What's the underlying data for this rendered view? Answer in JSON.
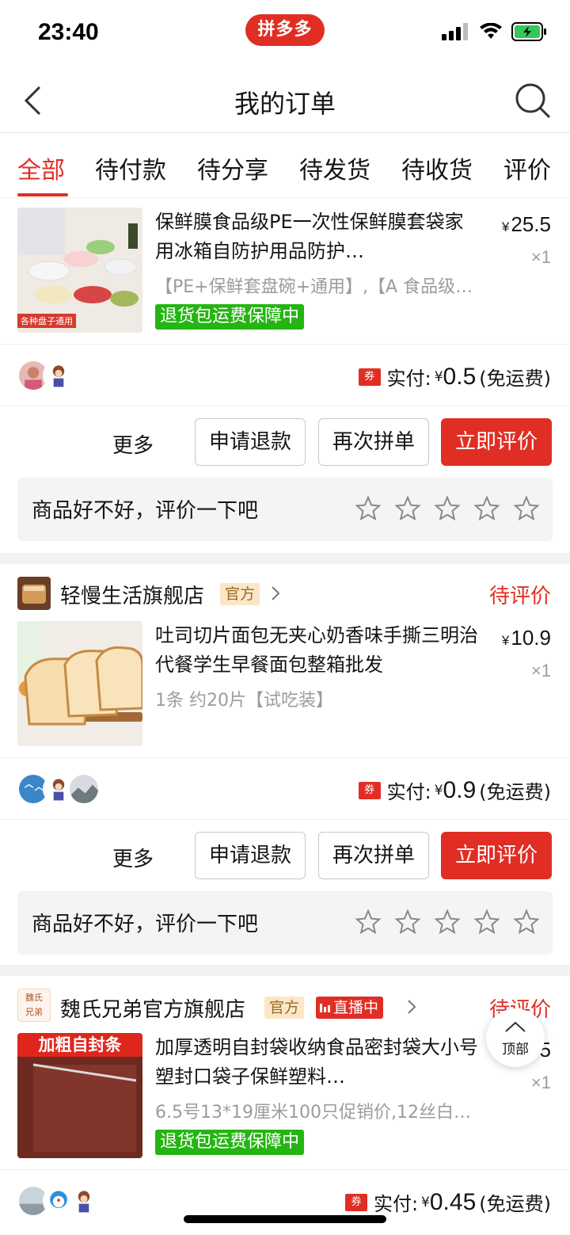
{
  "status_bar": {
    "time": "23:40",
    "brand": "拼多多"
  },
  "nav": {
    "title": "我的订单"
  },
  "tabs": [
    {
      "label": "全部",
      "active": true
    },
    {
      "label": "待付款"
    },
    {
      "label": "待分享"
    },
    {
      "label": "待发货"
    },
    {
      "label": "待收货"
    },
    {
      "label": "评价"
    }
  ],
  "orders": [
    {
      "product": {
        "title": "保鲜膜食品级PE一次性保鲜膜套袋家用冰箱自防护用品防护…",
        "spec": "【PE+保鲜套盘碗+通用】,【A 食品级…",
        "price": "25.5",
        "qty": "×1",
        "tag": "退货包运费保障中",
        "thumb_caption": "各种盘子通用"
      },
      "coupon": "券",
      "paid_label": "实付:",
      "paid_amount": "0.5",
      "shipping": "(免运费)",
      "actions": {
        "more": "更多",
        "refund": "申请退款",
        "reorder": "再次拼单",
        "review": "立即评价"
      },
      "rate_prompt": "商品好不好，评价一下吧",
      "rating": 0
    },
    {
      "shop": {
        "name": "轻慢生活旗舰店",
        "official": "官方"
      },
      "status": "待评价",
      "product": {
        "title": "吐司切片面包无夹心奶香味手撕三明治代餐学生早餐面包整箱批发",
        "spec": "1条 约20片【试吃装】",
        "price": "10.9",
        "qty": "×1"
      },
      "coupon": "券",
      "paid_label": "实付:",
      "paid_amount": "0.9",
      "shipping": "(免运费)",
      "actions": {
        "more": "更多",
        "refund": "申请退款",
        "reorder": "再次拼单",
        "review": "立即评价"
      },
      "rate_prompt": "商品好不好，评价一下吧",
      "rating": 0
    },
    {
      "shop": {
        "name": "魏氏兄弟官方旗舰店",
        "official": "官方",
        "live": "直播中",
        "icon_text_top": "魏氏",
        "icon_text_bottom": "兄弟"
      },
      "status": "待评价",
      "product": {
        "title": "加厚透明自封袋收纳食品密封袋大小号塑封口袋子保鲜塑料…",
        "spec": "6.5号13*19厘米100只促销价,12丝白…",
        "price_visible": "5",
        "qty": "×1",
        "tag": "退货包运费保障中",
        "thumb_caption": "加粗自封条"
      },
      "coupon": "券",
      "paid_label": "实付:",
      "paid_amount": "0.45",
      "shipping": "(免运费)"
    }
  ],
  "currency_symbol": "¥",
  "top_button": {
    "label": "顶部"
  },
  "colors": {
    "brand_red": "#e02e24",
    "guarantee_green": "#25b513",
    "official_bg": "#fbe6c6"
  }
}
